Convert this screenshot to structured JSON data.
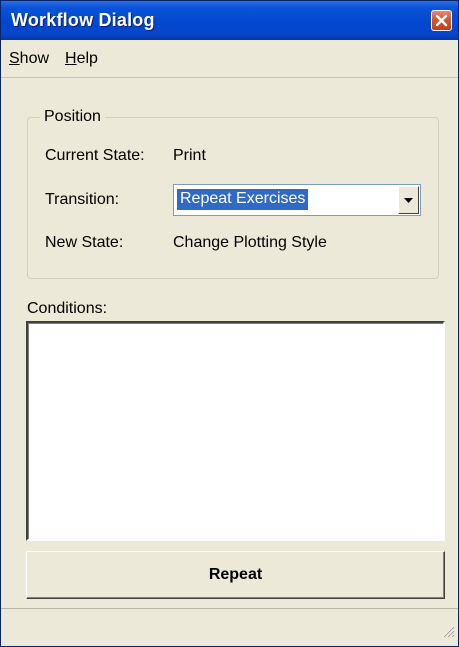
{
  "window": {
    "title": "Workflow Dialog",
    "close_icon": "close-icon"
  },
  "menu": {
    "items": [
      {
        "mnemonic": "S",
        "rest": "how",
        "label": "Show"
      },
      {
        "mnemonic": "H",
        "rest": "elp",
        "label": "Help"
      }
    ]
  },
  "position": {
    "group_label": "Position",
    "current_state_label": "Current State:",
    "current_state_value": "Print",
    "transition_label": "Transition:",
    "transition_value": "Repeat Exercises",
    "new_state_label": "New State:",
    "new_state_value": "Change Plotting Style"
  },
  "conditions": {
    "label": "Conditions:",
    "content": ""
  },
  "actions": {
    "repeat_label": "Repeat"
  },
  "colors": {
    "titlebar": "#0048d0",
    "window_bg": "#ece9d8",
    "selection": "#316ac5",
    "close_button": "#d5562f"
  }
}
